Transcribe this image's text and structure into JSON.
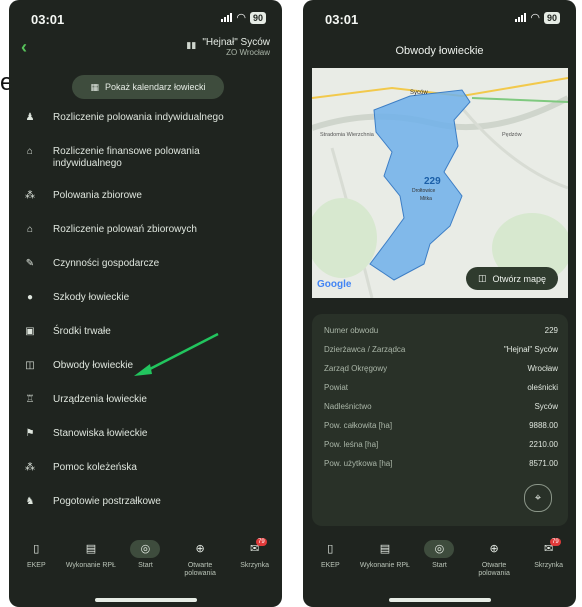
{
  "edge_char": "e",
  "status": {
    "time": "03:01",
    "battery": "90"
  },
  "left": {
    "club": {
      "name": "\"Hejnał\" Syców",
      "sub": "ZO Wrocław"
    },
    "calendar_button": "Pokaż kalendarz łowiecki",
    "menu": [
      {
        "icon": "person-icon",
        "glyph": "♟",
        "label": "Rozliczenie polowania indywidualnego"
      },
      {
        "icon": "bank-icon",
        "glyph": "⌂",
        "label": "Rozliczenie finansowe polowania indywidualnego"
      },
      {
        "icon": "group-icon",
        "glyph": "⁂",
        "label": "Polowania zbiorowe"
      },
      {
        "icon": "bank-group-icon",
        "glyph": "⌂",
        "label": "Rozliczenie polowań zbiorowych"
      },
      {
        "icon": "tools-icon",
        "glyph": "✎",
        "label": "Czynności gospodarcze"
      },
      {
        "icon": "damage-icon",
        "glyph": "●",
        "label": "Szkody łowieckie"
      },
      {
        "icon": "assets-icon",
        "glyph": "▣",
        "label": "Środki trwałe"
      },
      {
        "icon": "map-icon",
        "glyph": "◫",
        "label": "Obwody łowieckie"
      },
      {
        "icon": "tower-icon",
        "glyph": "♖",
        "label": "Urządzenia łowieckie"
      },
      {
        "icon": "flag-icon",
        "glyph": "⚑",
        "label": "Stanowiska łowieckie"
      },
      {
        "icon": "help-group-icon",
        "glyph": "⁂",
        "label": "Pomoc koleżeńska"
      },
      {
        "icon": "dog-icon",
        "glyph": "♞",
        "label": "Pogotowie postrzałkowe"
      }
    ]
  },
  "nav": [
    {
      "label": "EKEP",
      "glyph": "▯",
      "icon": "ekep-icon",
      "badge": ""
    },
    {
      "label": "Wykonanie RPŁ",
      "glyph": "▤",
      "icon": "plan-icon",
      "badge": ""
    },
    {
      "label": "Start",
      "glyph": "◎",
      "icon": "start-icon",
      "badge": ""
    },
    {
      "label": "Otwarte polowania",
      "glyph": "⊕",
      "icon": "crosshair-icon",
      "badge": ""
    },
    {
      "label": "Skrzynka",
      "glyph": "✉",
      "icon": "inbox-icon",
      "badge": "79"
    }
  ],
  "right": {
    "title": "Obwody łowieckie",
    "map": {
      "labels": [
        "Syców",
        "Stradomia Wierzchnia",
        "Pędzów",
        "229",
        "Drołtowice",
        "Mitka"
      ],
      "google": "Google",
      "open_button": "Otwórz mapę"
    },
    "info": [
      {
        "label": "Numer obwodu",
        "value": "229"
      },
      {
        "label": "Dzierżawca / Zarządca",
        "value": "\"Hejnał\" Syców"
      },
      {
        "label": "Zarząd Okręgowy",
        "value": "Wrocław"
      },
      {
        "label": "Powiat",
        "value": "oleśnicki"
      },
      {
        "label": "Nadleśnictwo",
        "value": "Syców"
      },
      {
        "label": "Pow. całkowita [ha]",
        "value": "9888.00"
      },
      {
        "label": "Pow. leśna [ha]",
        "value": "2210.00"
      },
      {
        "label": "Pow. użytkowa [ha]",
        "value": "8571.00"
      }
    ]
  },
  "colors": {
    "accent": "#57c25a",
    "background": "#1f241f",
    "card": "#293128",
    "polygon": "#6fb0ea"
  }
}
